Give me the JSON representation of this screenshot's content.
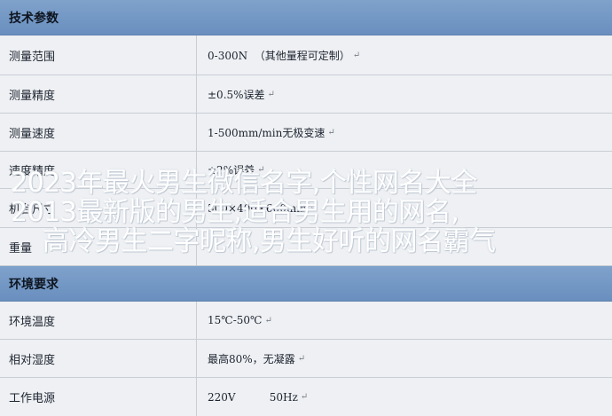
{
  "sections": {
    "tech_params": "技术参数",
    "environment": "环境要求"
  },
  "tech_rows": [
    {
      "label": "测量范围",
      "value": "0-300N  （其他量程可定制）"
    },
    {
      "label": "测量精度",
      "value": "±0.5%误差"
    },
    {
      "label": "测量速度",
      "value": "1-500mm/min无极变速"
    },
    {
      "label": "速度精度",
      "value": "±2%误差"
    },
    {
      "label": "机台尺寸",
      "value": "500×400×600mm"
    },
    {
      "label": "重量",
      "value": ""
    }
  ],
  "env_rows": [
    {
      "label": "环境温度",
      "value": "15℃-50℃"
    },
    {
      "label": "相对湿度",
      "value": "最高80%，无凝露"
    },
    {
      "label": "工作电源",
      "value": "220V          50Hz"
    }
  ],
  "paragraph_mark": "↵",
  "overlay": {
    "line1": "2023年最火男生微信名字,个性网名大全",
    "line2": "2013最新版的男生,适合男生用的网名,",
    "line3": "高冷男生二字昵称,男生好听的网名霸气"
  }
}
